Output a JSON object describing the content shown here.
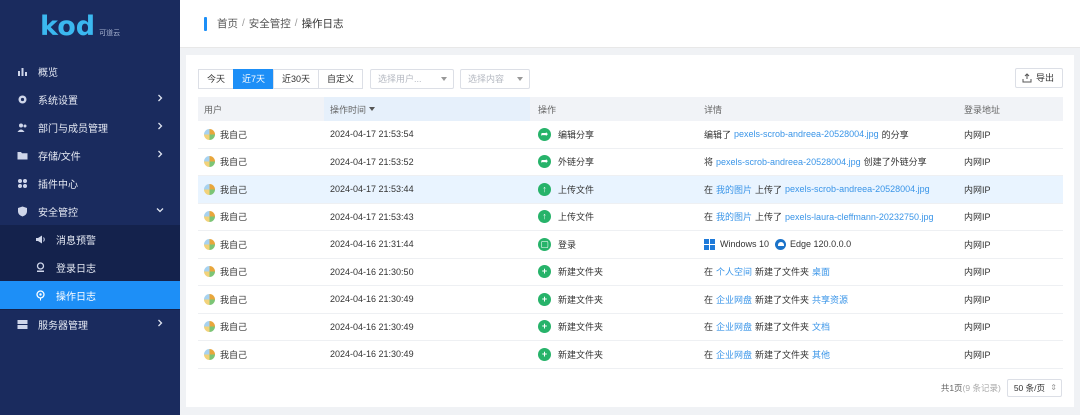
{
  "logo": {
    "text": "kod",
    "sub": "可道云"
  },
  "sidebar": {
    "items": [
      {
        "label": "概览",
        "icon": "bar-chart-icon"
      },
      {
        "label": "系统设置",
        "icon": "gear-icon",
        "expandable": true
      },
      {
        "label": "部门与成员管理",
        "icon": "users-icon",
        "expandable": true
      },
      {
        "label": "存储/文件",
        "icon": "folder-icon",
        "expandable": true
      },
      {
        "label": "插件中心",
        "icon": "grid-icon"
      },
      {
        "label": "安全管控",
        "icon": "shield-icon",
        "expanded": true
      },
      {
        "label": "消息预警",
        "icon": "megaphone-icon",
        "sub": true
      },
      {
        "label": "登录日志",
        "icon": "login-log-icon",
        "sub": true
      },
      {
        "label": "操作日志",
        "icon": "pin-icon",
        "sub": true,
        "active": true
      },
      {
        "label": "服务器管理",
        "icon": "server-icon",
        "expandable": true
      }
    ]
  },
  "breadcrumb": {
    "home": "首页",
    "section": "安全管控",
    "current": "操作日志",
    "sep": "/"
  },
  "filters": {
    "ranges": [
      "今天",
      "近7天",
      "近30天",
      "自定义"
    ],
    "active_range": "近7天",
    "user_select_placeholder": "选择用户...",
    "content_select_placeholder": "选择内容",
    "export_label": "导出"
  },
  "table": {
    "headers": {
      "user": "用户",
      "time": "操作时间",
      "action": "操作",
      "detail": "详情",
      "ip": "登录地址"
    },
    "rows": [
      {
        "user": "我自己",
        "time": "2024-04-17 21:53:54",
        "action": "编辑分享",
        "icon": "share-icon",
        "detail": [
          [
            "plain",
            "编辑了"
          ],
          [
            "link",
            "pexels-scrob-andreea-20528004.jpg"
          ],
          [
            "plain",
            "的分享"
          ]
        ],
        "ip": "内网IP"
      },
      {
        "user": "我自己",
        "time": "2024-04-17 21:53:52",
        "action": "外链分享",
        "icon": "share-icon",
        "detail": [
          [
            "plain",
            "将"
          ],
          [
            "link",
            "pexels-scrob-andreea-20528004.jpg"
          ],
          [
            "plain",
            "创建了外链分享"
          ]
        ],
        "ip": "内网IP"
      },
      {
        "user": "我自己",
        "time": "2024-04-17 21:53:44",
        "action": "上传文件",
        "icon": "upload-icon",
        "detail": [
          [
            "plain",
            "在"
          ],
          [
            "link",
            "我的图片"
          ],
          [
            "plain",
            "上传了"
          ],
          [
            "link",
            "pexels-scrob-andreea-20528004.jpg"
          ]
        ],
        "ip": "内网IP",
        "highlight": true
      },
      {
        "user": "我自己",
        "time": "2024-04-17 21:53:43",
        "action": "上传文件",
        "icon": "upload-icon",
        "detail": [
          [
            "plain",
            "在"
          ],
          [
            "link",
            "我的图片"
          ],
          [
            "plain",
            "上传了"
          ],
          [
            "link",
            "pexels-laura-cleffmann-20232750.jpg"
          ]
        ],
        "ip": "内网IP"
      },
      {
        "user": "我自己",
        "time": "2024-04-16 21:31:44",
        "action": "登录",
        "icon": "login-icon",
        "detail_os": "Windows 10",
        "detail_browser": "Edge 120.0.0.0",
        "ip": "内网IP"
      },
      {
        "user": "我自己",
        "time": "2024-04-16 21:30:50",
        "action": "新建文件夹",
        "icon": "plus-icon",
        "detail": [
          [
            "plain",
            "在"
          ],
          [
            "link",
            "个人空间"
          ],
          [
            "plain",
            "新建了文件夹"
          ],
          [
            "link",
            "桌面"
          ]
        ],
        "ip": "内网IP"
      },
      {
        "user": "我自己",
        "time": "2024-04-16 21:30:49",
        "action": "新建文件夹",
        "icon": "plus-icon",
        "detail": [
          [
            "plain",
            "在"
          ],
          [
            "link",
            "企业网盘"
          ],
          [
            "plain",
            "新建了文件夹"
          ],
          [
            "link",
            "共享资源"
          ]
        ],
        "ip": "内网IP"
      },
      {
        "user": "我自己",
        "time": "2024-04-16 21:30:49",
        "action": "新建文件夹",
        "icon": "plus-icon",
        "detail": [
          [
            "plain",
            "在"
          ],
          [
            "link",
            "企业网盘"
          ],
          [
            "plain",
            "新建了文件夹"
          ],
          [
            "link",
            "文档"
          ]
        ],
        "ip": "内网IP"
      },
      {
        "user": "我自己",
        "time": "2024-04-16 21:30:49",
        "action": "新建文件夹",
        "icon": "plus-icon",
        "detail": [
          [
            "plain",
            "在"
          ],
          [
            "link",
            "企业网盘"
          ],
          [
            "plain",
            "新建了文件夹"
          ],
          [
            "link",
            "其他"
          ]
        ],
        "ip": "内网IP"
      }
    ]
  },
  "pager": {
    "summary": "共1页",
    "records": "(9 条记录)",
    "page_size": "50 条/页"
  },
  "colors": {
    "sidebar": "#1a2b5e",
    "accent": "#1d8ff7",
    "action_icon": "#27b36a",
    "link": "#3a95e8"
  }
}
